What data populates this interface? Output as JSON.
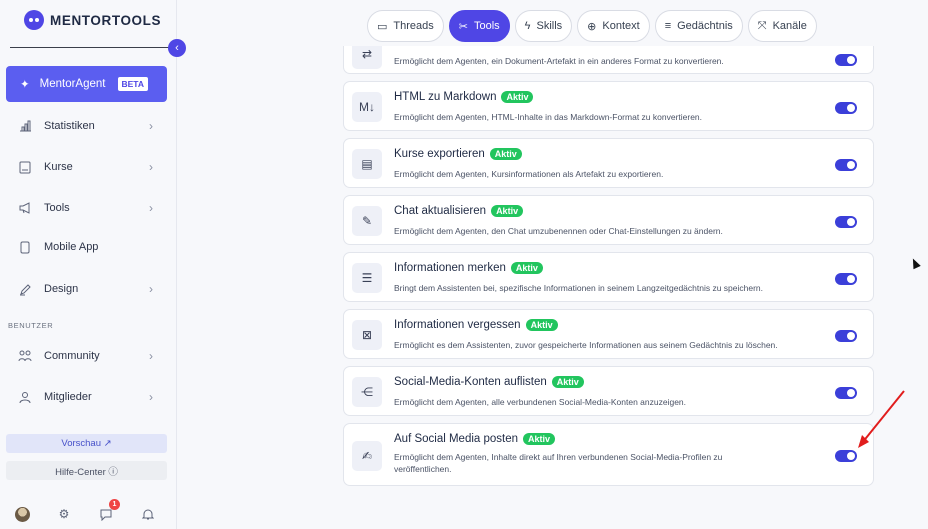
{
  "sidebar": {
    "logo_text": "MENTORTOOLS",
    "collapse_icon": "chevron-left-icon",
    "active_item": {
      "label": "MentorAgent",
      "badge": "BETA",
      "icon": "sparkle-icon"
    },
    "items": [
      {
        "label": "Statistiken",
        "icon": "chart-icon",
        "has_chevron": true
      },
      {
        "label": "Kurse",
        "icon": "book-icon",
        "has_chevron": true
      },
      {
        "label": "Tools",
        "icon": "megaphone-icon",
        "has_chevron": true
      },
      {
        "label": "Mobile App",
        "icon": "phone-icon",
        "has_chevron": false
      },
      {
        "label": "Design",
        "icon": "brush-icon",
        "has_chevron": true
      }
    ],
    "section_label": "BENUTZER",
    "user_items": [
      {
        "label": "Community",
        "icon": "people-icon",
        "has_chevron": true
      },
      {
        "label": "Mitglieder",
        "icon": "person-icon",
        "has_chevron": true
      }
    ],
    "preview_label": "Vorschau ↗",
    "help_label": "Hilfe-Center ⓘ",
    "notification_count": "1"
  },
  "tabs": [
    {
      "label": "Threads",
      "icon": "chat-icon",
      "active": false
    },
    {
      "label": "Tools",
      "icon": "tools-icon",
      "active": true
    },
    {
      "label": "Skills",
      "icon": "bolt-icon",
      "active": false
    },
    {
      "label": "Kontext",
      "icon": "globe-icon",
      "active": false
    },
    {
      "label": "Gedächtnis",
      "icon": "database-icon",
      "active": false
    },
    {
      "label": "Kanäle",
      "icon": "channels-icon",
      "active": false
    }
  ],
  "tools": [
    {
      "title": "",
      "badge": "",
      "desc": "Ermöglicht dem Agenten, ein Dokument-Artefakt in ein anderes Format zu konvertieren.",
      "icon": "convert-icon",
      "enabled": true
    },
    {
      "title": "HTML zu Markdown",
      "badge": "Aktiv",
      "desc": "Ermöglicht dem Agenten, HTML-Inhalte in das Markdown-Format zu konvertieren.",
      "icon": "markdown-icon",
      "enabled": true
    },
    {
      "title": "Kurse exportieren",
      "badge": "Aktiv",
      "desc": "Ermöglicht dem Agenten, Kursinformationen als Artefakt zu exportieren.",
      "icon": "archive-icon",
      "enabled": true
    },
    {
      "title": "Chat aktualisieren",
      "badge": "Aktiv",
      "desc": "Ermöglicht dem Agenten, den Chat umzubenennen oder Chat-Einstellungen zu ändern.",
      "icon": "edit-icon",
      "enabled": true
    },
    {
      "title": "Informationen merken",
      "badge": "Aktiv",
      "desc": "Bringt dem Assistenten bei, spezifische Informationen in seinem Langzeitgedächtnis zu speichern.",
      "icon": "database-icon",
      "enabled": true
    },
    {
      "title": "Informationen vergessen",
      "badge": "Aktiv",
      "desc": "Ermöglicht es dem Assistenten, zuvor gespeicherte Informationen aus seinem Gedächtnis zu löschen.",
      "icon": "database-x-icon",
      "enabled": true
    },
    {
      "title": "Social-Media-Konten auflisten",
      "badge": "Aktiv",
      "desc": "Ermöglicht dem Agenten, alle verbundenen Social-Media-Konten anzuzeigen.",
      "icon": "share-icon",
      "enabled": true
    },
    {
      "title": "Auf Social Media posten",
      "badge": "Aktiv",
      "desc": "Ermöglicht dem Agenten, Inhalte direkt auf Ihren verbundenen Social-Media-Profilen zu veröffentlichen.",
      "icon": "pen-send-icon",
      "enabled": true
    }
  ],
  "colors": {
    "accent": "#4f46e5",
    "badge_green": "#22c55e",
    "annotation_red": "#e11d1d"
  }
}
